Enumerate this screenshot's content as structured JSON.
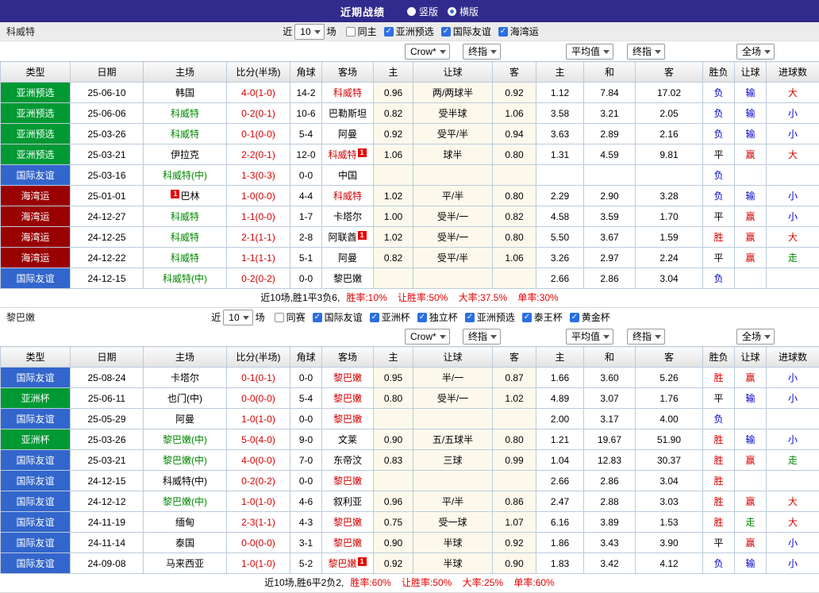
{
  "title_bar": {
    "title": "近期战绩",
    "options": [
      {
        "label": "竖版",
        "selected": false
      },
      {
        "label": "横版",
        "selected": true
      }
    ]
  },
  "odds_selects": [
    "Crow*",
    "终指",
    "平均值",
    "终指",
    "全场"
  ],
  "table_headers": [
    "类型",
    "日期",
    "主场",
    "比分(半场)",
    "角球",
    "客场",
    "主",
    "让球",
    "客",
    "主",
    "和",
    "客",
    "胜负",
    "让球",
    "进球数"
  ],
  "colors": {
    "title_bar_bg": "#302b8c",
    "type_green": "#009933",
    "type_blue": "#3366cc",
    "type_maroon": "#990000",
    "win_red": "#d40000",
    "lose_blue": "#0000cc",
    "push_green": "#008800",
    "checkbox_blue": "#2b6fe3"
  },
  "sections": [
    {
      "team": "科威特",
      "filter": {
        "near": "近",
        "count": "10",
        "games": "场",
        "options": [
          {
            "label": "同主",
            "checked": false
          },
          {
            "label": "亚洲预选",
            "checked": true
          },
          {
            "label": "国际友谊",
            "checked": true
          },
          {
            "label": "海湾运",
            "checked": true
          }
        ]
      },
      "rows": [
        {
          "type": "亚洲预选",
          "type_color": "green",
          "date": "25-06-10",
          "home": "韩国",
          "home_color": "",
          "home_badge": "",
          "score": "4-0(1-0)",
          "corners": "14-2",
          "away": "科威特",
          "away_color": "red",
          "away_badge": "",
          "odds": [
            "0.96",
            "两/两球半",
            "0.92"
          ],
          "avg": [
            "1.12",
            "7.84",
            "17.02"
          ],
          "result": "负",
          "result_color": "blue",
          "handicap": "输",
          "handicap_color": "blue",
          "goals": "大",
          "goals_color": "red"
        },
        {
          "type": "亚洲预选",
          "type_color": "green",
          "date": "25-06-06",
          "home": "科威特",
          "home_color": "green",
          "home_badge": "",
          "score": "0-2(0-1)",
          "corners": "10-6",
          "away": "巴勒斯坦",
          "away_color": "",
          "away_badge": "",
          "odds": [
            "0.82",
            "受半球",
            "1.06"
          ],
          "avg": [
            "3.58",
            "3.21",
            "2.05"
          ],
          "result": "负",
          "result_color": "blue",
          "handicap": "输",
          "handicap_color": "blue",
          "goals": "小",
          "goals_color": "blue"
        },
        {
          "type": "亚洲预选",
          "type_color": "green",
          "date": "25-03-26",
          "home": "科威特",
          "home_color": "green",
          "home_badge": "",
          "score": "0-1(0-0)",
          "corners": "5-4",
          "away": "阿曼",
          "away_color": "",
          "away_badge": "",
          "odds": [
            "0.92",
            "受平/半",
            "0.94"
          ],
          "avg": [
            "3.63",
            "2.89",
            "2.16"
          ],
          "result": "负",
          "result_color": "blue",
          "handicap": "输",
          "handicap_color": "blue",
          "goals": "小",
          "goals_color": "blue"
        },
        {
          "type": "亚洲预选",
          "type_color": "green",
          "date": "25-03-21",
          "home": "伊拉克",
          "home_color": "",
          "home_badge": "",
          "score": "2-2(0-1)",
          "corners": "12-0",
          "away": "科威特",
          "away_color": "red",
          "away_badge": "1",
          "odds": [
            "1.06",
            "球半",
            "0.80"
          ],
          "avg": [
            "1.31",
            "4.59",
            "9.81"
          ],
          "result": "平",
          "result_color": "",
          "handicap": "赢",
          "handicap_color": "red",
          "goals": "大",
          "goals_color": "red"
        },
        {
          "type": "国际友谊",
          "type_color": "blue",
          "date": "25-03-16",
          "home": "科威特(中)",
          "home_color": "green",
          "home_badge": "",
          "score": "1-3(0-3)",
          "corners": "0-0",
          "away": "中国",
          "away_color": "",
          "away_badge": "",
          "odds": [
            "",
            "",
            ""
          ],
          "avg": [
            "",
            "",
            ""
          ],
          "result": "负",
          "result_color": "blue",
          "handicap": "",
          "handicap_color": "",
          "goals": "",
          "goals_color": ""
        },
        {
          "type": "海湾运",
          "type_color": "maroon",
          "date": "25-01-01",
          "home": "巴林",
          "home_color": "",
          "home_badge": "1",
          "score": "1-0(0-0)",
          "corners": "4-4",
          "away": "科威特",
          "away_color": "red",
          "away_badge": "",
          "odds": [
            "1.02",
            "平/半",
            "0.80"
          ],
          "avg": [
            "2.29",
            "2.90",
            "3.28"
          ],
          "result": "负",
          "result_color": "blue",
          "handicap": "输",
          "handicap_color": "blue",
          "goals": "小",
          "goals_color": "blue"
        },
        {
          "type": "海湾运",
          "type_color": "maroon",
          "date": "24-12-27",
          "home": "科威特",
          "home_color": "green",
          "home_badge": "",
          "score": "1-1(0-0)",
          "corners": "1-7",
          "away": "卡塔尔",
          "away_color": "",
          "away_badge": "",
          "odds": [
            "1.00",
            "受半/一",
            "0.82"
          ],
          "avg": [
            "4.58",
            "3.59",
            "1.70"
          ],
          "result": "平",
          "result_color": "",
          "handicap": "赢",
          "handicap_color": "red",
          "goals": "小",
          "goals_color": "blue"
        },
        {
          "type": "海湾运",
          "type_color": "maroon",
          "date": "24-12-25",
          "home": "科威特",
          "home_color": "green",
          "home_badge": "",
          "score": "2-1(1-1)",
          "corners": "2-8",
          "away": "阿联酋",
          "away_color": "",
          "away_badge": "1",
          "odds": [
            "1.02",
            "受半/一",
            "0.80"
          ],
          "avg": [
            "5.50",
            "3.67",
            "1.59"
          ],
          "result": "胜",
          "result_color": "red",
          "handicap": "赢",
          "handicap_color": "red",
          "goals": "大",
          "goals_color": "red"
        },
        {
          "type": "海湾运",
          "type_color": "maroon",
          "date": "24-12-22",
          "home": "科威特",
          "home_color": "green",
          "home_badge": "",
          "score": "1-1(1-1)",
          "corners": "5-1",
          "away": "阿曼",
          "away_color": "",
          "away_badge": "",
          "odds": [
            "0.82",
            "受平/半",
            "1.06"
          ],
          "avg": [
            "3.26",
            "2.97",
            "2.24"
          ],
          "result": "平",
          "result_color": "",
          "handicap": "赢",
          "handicap_color": "red",
          "goals": "走",
          "goals_color": "green"
        },
        {
          "type": "国际友谊",
          "type_color": "blue",
          "date": "24-12-15",
          "home": "科威特(中)",
          "home_color": "green",
          "home_badge": "",
          "score": "0-2(0-2)",
          "corners": "0-0",
          "away": "黎巴嫩",
          "away_color": "",
          "away_badge": "",
          "odds": [
            "",
            "",
            ""
          ],
          "avg": [
            "2.66",
            "2.86",
            "3.04"
          ],
          "result": "负",
          "result_color": "blue",
          "handicap": "",
          "handicap_color": "",
          "goals": "",
          "goals_color": ""
        }
      ],
      "summary": {
        "record": "近10场,胜1平3负6,",
        "stats": "胜率:10% 让胜率:50% 大率:37.5% 单率:30%"
      }
    },
    {
      "team": "黎巴嫩",
      "filter": {
        "near": "近",
        "count": "10",
        "games": "场",
        "options": [
          {
            "label": "同赛",
            "checked": false
          },
          {
            "label": "国际友谊",
            "checked": true
          },
          {
            "label": "亚洲杯",
            "checked": true
          },
          {
            "label": "独立杯",
            "checked": true
          },
          {
            "label": "亚洲预选",
            "checked": true
          },
          {
            "label": "泰王杯",
            "checked": true
          },
          {
            "label": "黄金杯",
            "checked": true
          }
        ]
      },
      "rows": [
        {
          "type": "国际友谊",
          "type_color": "blue",
          "date": "25-08-24",
          "home": "卡塔尔",
          "home_color": "",
          "home_badge": "",
          "score": "0-1(0-1)",
          "corners": "0-0",
          "away": "黎巴嫩",
          "away_color": "red",
          "away_badge": "",
          "odds": [
            "0.95",
            "半/一",
            "0.87"
          ],
          "avg": [
            "1.66",
            "3.60",
            "5.26"
          ],
          "result": "胜",
          "result_color": "red",
          "handicap": "赢",
          "handicap_color": "red",
          "goals": "小",
          "goals_color": "blue"
        },
        {
          "type": "亚洲杯",
          "type_color": "green",
          "date": "25-06-11",
          "home": "也门(中)",
          "home_color": "",
          "home_badge": "",
          "score": "0-0(0-0)",
          "corners": "5-4",
          "away": "黎巴嫩",
          "away_color": "red",
          "away_badge": "",
          "odds": [
            "0.80",
            "受半/一",
            "1.02"
          ],
          "avg": [
            "4.89",
            "3.07",
            "1.76"
          ],
          "result": "平",
          "result_color": "",
          "handicap": "输",
          "handicap_color": "blue",
          "goals": "小",
          "goals_color": "blue"
        },
        {
          "type": "国际友谊",
          "type_color": "blue",
          "date": "25-05-29",
          "home": "阿曼",
          "home_color": "",
          "home_badge": "",
          "score": "1-0(1-0)",
          "corners": "0-0",
          "away": "黎巴嫩",
          "away_color": "red",
          "away_badge": "",
          "odds": [
            "",
            "",
            ""
          ],
          "avg": [
            "2.00",
            "3.17",
            "4.00"
          ],
          "result": "负",
          "result_color": "blue",
          "handicap": "",
          "handicap_color": "",
          "goals": "",
          "goals_color": ""
        },
        {
          "type": "亚洲杯",
          "type_color": "green",
          "date": "25-03-26",
          "home": "黎巴嫩(中)",
          "home_color": "green",
          "home_badge": "",
          "score": "5-0(4-0)",
          "corners": "9-0",
          "away": "文莱",
          "away_color": "",
          "away_badge": "",
          "odds": [
            "0.90",
            "五/五球半",
            "0.80"
          ],
          "avg": [
            "1.21",
            "19.67",
            "51.90"
          ],
          "result": "胜",
          "result_color": "red",
          "handicap": "输",
          "handicap_color": "blue",
          "goals": "小",
          "goals_color": "blue"
        },
        {
          "type": "国际友谊",
          "type_color": "blue",
          "date": "25-03-21",
          "home": "黎巴嫩(中)",
          "home_color": "green",
          "home_badge": "",
          "score": "4-0(0-0)",
          "corners": "7-0",
          "away": "东帝汶",
          "away_color": "",
          "away_badge": "",
          "odds": [
            "0.83",
            "三球",
            "0.99"
          ],
          "avg": [
            "1.04",
            "12.83",
            "30.37"
          ],
          "result": "胜",
          "result_color": "red",
          "handicap": "赢",
          "handicap_color": "red",
          "goals": "走",
          "goals_color": "green"
        },
        {
          "type": "国际友谊",
          "type_color": "blue",
          "date": "24-12-15",
          "home": "科威特(中)",
          "home_color": "",
          "home_badge": "",
          "score": "0-2(0-2)",
          "corners": "0-0",
          "away": "黎巴嫩",
          "away_color": "red",
          "away_badge": "",
          "odds": [
            "",
            "",
            ""
          ],
          "avg": [
            "2.66",
            "2.86",
            "3.04"
          ],
          "result": "胜",
          "result_color": "red",
          "handicap": "",
          "handicap_color": "",
          "goals": "",
          "goals_color": ""
        },
        {
          "type": "国际友谊",
          "type_color": "blue",
          "date": "24-12-12",
          "home": "黎巴嫩(中)",
          "home_color": "green",
          "home_badge": "",
          "score": "1-0(1-0)",
          "corners": "4-6",
          "away": "叙利亚",
          "away_color": "",
          "away_badge": "",
          "odds": [
            "0.96",
            "平/半",
            "0.86"
          ],
          "avg": [
            "2.47",
            "2.88",
            "3.03"
          ],
          "result": "胜",
          "result_color": "red",
          "handicap": "赢",
          "handicap_color": "red",
          "goals": "大",
          "goals_color": "red"
        },
        {
          "type": "国际友谊",
          "type_color": "blue",
          "date": "24-11-19",
          "home": "缅甸",
          "home_color": "",
          "home_badge": "",
          "score": "2-3(1-1)",
          "corners": "4-3",
          "away": "黎巴嫩",
          "away_color": "red",
          "away_badge": "",
          "odds": [
            "0.75",
            "受一球",
            "1.07"
          ],
          "avg": [
            "6.16",
            "3.89",
            "1.53"
          ],
          "result": "胜",
          "result_color": "red",
          "handicap": "走",
          "handicap_color": "green",
          "goals": "大",
          "goals_color": "red"
        },
        {
          "type": "国际友谊",
          "type_color": "blue",
          "date": "24-11-14",
          "home": "泰国",
          "home_color": "",
          "home_badge": "",
          "score": "0-0(0-0)",
          "corners": "3-1",
          "away": "黎巴嫩",
          "away_color": "red",
          "away_badge": "",
          "odds": [
            "0.90",
            "半球",
            "0.92"
          ],
          "avg": [
            "1.86",
            "3.43",
            "3.90"
          ],
          "result": "平",
          "result_color": "",
          "handicap": "赢",
          "handicap_color": "red",
          "goals": "小",
          "goals_color": "blue"
        },
        {
          "type": "国际友谊",
          "type_color": "blue",
          "date": "24-09-08",
          "home": "马来西亚",
          "home_color": "",
          "home_badge": "",
          "score": "1-0(1-0)",
          "corners": "5-2",
          "away": "黎巴嫩",
          "away_color": "red",
          "away_badge": "1",
          "odds": [
            "0.92",
            "半球",
            "0.90"
          ],
          "avg": [
            "1.83",
            "3.42",
            "4.12"
          ],
          "result": "负",
          "result_color": "blue",
          "handicap": "输",
          "handicap_color": "blue",
          "goals": "小",
          "goals_color": "blue"
        }
      ],
      "summary": {
        "record": "近10场,胜6平2负2,",
        "stats": "胜率:60% 让胜率:50% 大率:25% 单率:60%"
      }
    }
  ]
}
